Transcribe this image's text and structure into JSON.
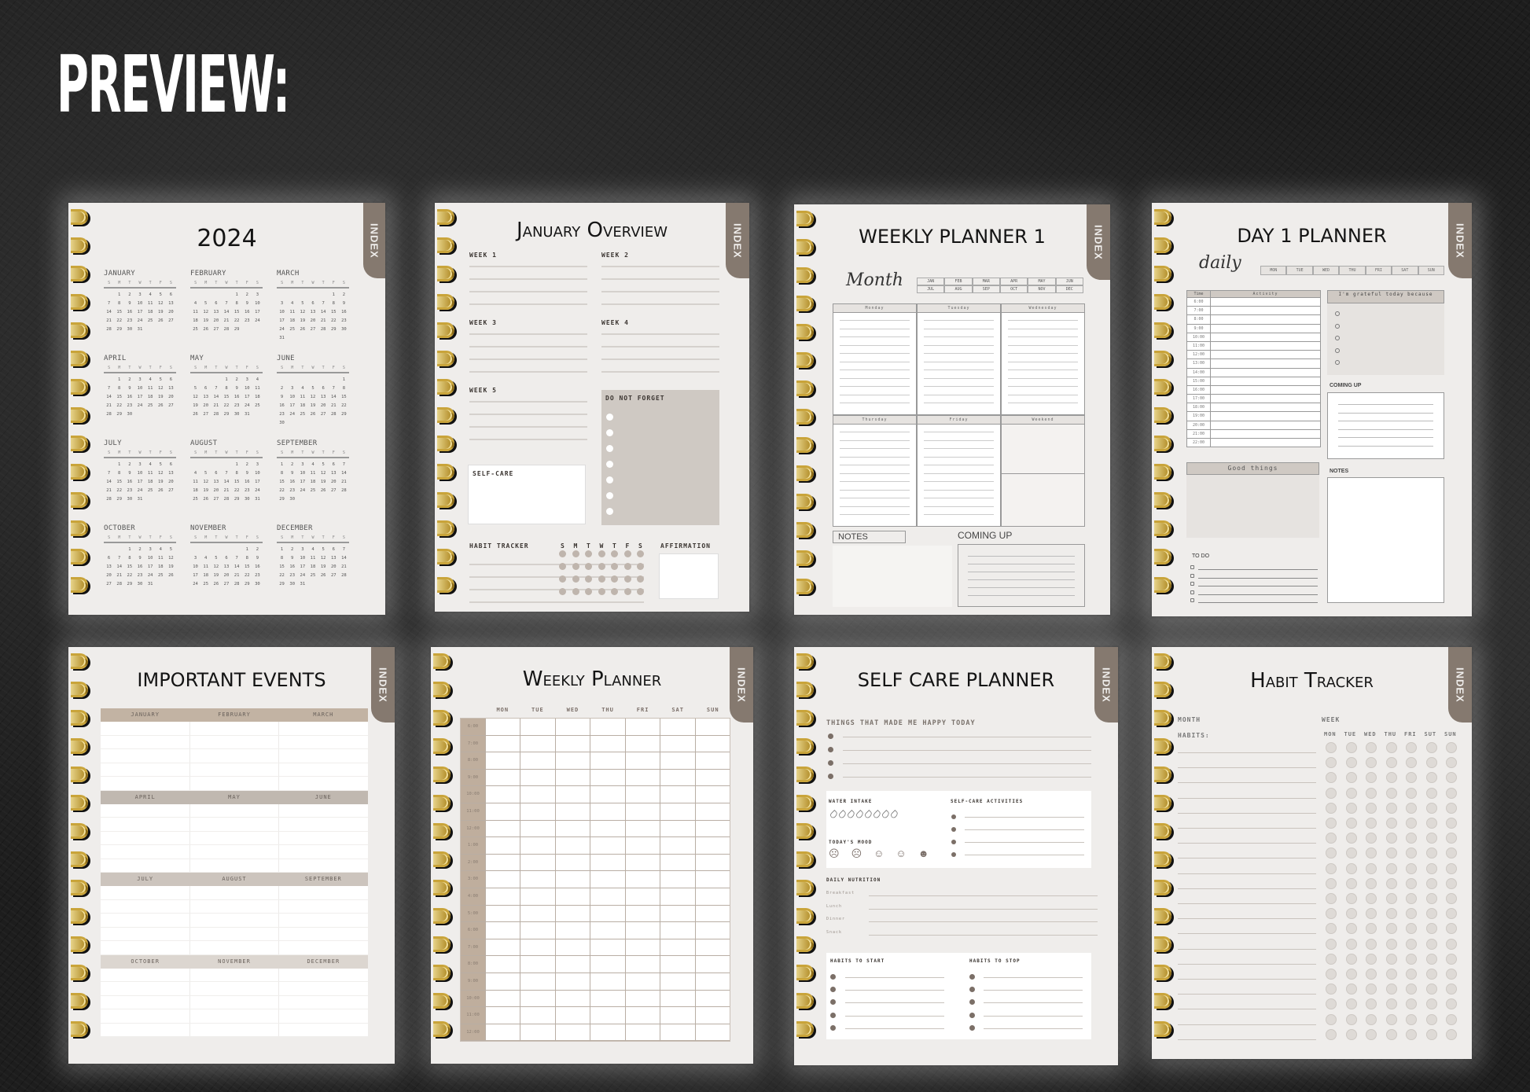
{
  "headline": "PREVIEW:",
  "index_label": "INDEX",
  "colors": {
    "accent_taupe": "#85796f",
    "tan": "#bfaf9f",
    "page": "#efedeb",
    "ring_gold": "#c9a43a"
  },
  "calendar": {
    "title": "2024",
    "dow": [
      "S",
      "M",
      "T",
      "W",
      "T",
      "F",
      "S"
    ],
    "months": [
      {
        "name": "JANUARY",
        "offset": 1,
        "days": 31
      },
      {
        "name": "FEBRUARY",
        "offset": 4,
        "days": 29
      },
      {
        "name": "MARCH",
        "offset": 5,
        "days": 31
      },
      {
        "name": "APRIL",
        "offset": 1,
        "days": 30
      },
      {
        "name": "MAY",
        "offset": 3,
        "days": 31
      },
      {
        "name": "JUNE",
        "offset": 6,
        "days": 30
      },
      {
        "name": "JULY",
        "offset": 1,
        "days": 31
      },
      {
        "name": "AUGUST",
        "offset": 4,
        "days": 31
      },
      {
        "name": "SEPTEMBER",
        "offset": 0,
        "days": 30
      },
      {
        "name": "OCTOBER",
        "offset": 2,
        "days": 31
      },
      {
        "name": "NOVEMBER",
        "offset": 5,
        "days": 30
      },
      {
        "name": "DECEMBER",
        "offset": 0,
        "days": 31
      }
    ]
  },
  "january_overview": {
    "title": "January Overview",
    "weeks": [
      "WEEK 1",
      "WEEK 2",
      "WEEK 3",
      "WEEK 4",
      "WEEK 5"
    ],
    "self_care": "SELF-CARE",
    "do_not_forget": "DO NOT FORGET",
    "habit_tracker": "HABIT TRACKER",
    "habit_days": [
      "S",
      "M",
      "T",
      "W",
      "T",
      "F",
      "S"
    ],
    "affirmation": "AFFIRMATION"
  },
  "weekly_planner_1": {
    "title": "WEEKLY PLANNER 1",
    "script_label": "Month",
    "months_row1": [
      "JAN",
      "FEB",
      "MAR",
      "APR",
      "MAY",
      "JUN"
    ],
    "months_row2": [
      "JUL",
      "AUG",
      "SEP",
      "OCT",
      "NOV",
      "DEC"
    ],
    "days": [
      "Monday",
      "Tuesday",
      "Wednesday",
      "Thursday",
      "Friday",
      "Weekend"
    ],
    "notes": "NOTES",
    "coming_up": "COMING UP"
  },
  "day_planner": {
    "title": "DAY 1 PLANNER",
    "script_label": "daily",
    "days": [
      "MON",
      "TUE",
      "WED",
      "THU",
      "FRI",
      "SAT",
      "SUN"
    ],
    "time_header": "Time",
    "activity_header": "Activity",
    "times": [
      "6:00",
      "7:00",
      "8:00",
      "9:00",
      "10:00",
      "11:00",
      "12:00",
      "13:00",
      "14:00",
      "15:00",
      "16:00",
      "17:00",
      "18:00",
      "19:00",
      "20:00",
      "21:00",
      "22:00"
    ],
    "grateful": "I'm grateful today because",
    "coming_up": "COMING UP",
    "good_things": "Good things",
    "notes": "NOTES",
    "todo": "TO DO"
  },
  "important_events": {
    "title": "IMPORTANT EVENTS",
    "quarters": [
      [
        "JANUARY",
        "FEBRUARY",
        "MARCH"
      ],
      [
        "APRIL",
        "MAY",
        "JUNE"
      ],
      [
        "JULY",
        "AUGUST",
        "SEPTEMBER"
      ],
      [
        "OCTOBER",
        "NOVEMBER",
        "DECEMBER"
      ]
    ]
  },
  "weekly_planner": {
    "title": "Weekly Planner",
    "days": [
      "MON",
      "TUE",
      "WED",
      "THU",
      "FRI",
      "SAT",
      "SUN"
    ],
    "times": [
      "6:00",
      "7:00",
      "8:00",
      "9:00",
      "10:00",
      "11:00",
      "12:00",
      "1:00",
      "2:00",
      "3:00",
      "4:00",
      "5:00",
      "6:00",
      "7:00",
      "8:00",
      "9:00",
      "10:00",
      "11:00",
      "12:00"
    ]
  },
  "self_care": {
    "title": "SELF CARE PLANNER",
    "happy": "THINGS THAT MADE ME HAPPY TODAY",
    "water": "WATER INTAKE",
    "water_drops": 8,
    "mood": "TODAY'S MOOD",
    "moods": [
      "☹",
      "☹",
      "☺",
      "☺",
      "☻"
    ],
    "activities": "SELF-CARE ACTIVITIES",
    "nutrition": "DAILY NUTRITION",
    "meals": [
      "Breakfast",
      "Lunch",
      "Dinner",
      "Snack"
    ],
    "habits_start": "HABITS TO START",
    "habits_stop": "HABITS TO STOP"
  },
  "habit_tracker": {
    "title": "Habit Tracker",
    "month": "MONTH",
    "habits": "HABITS:",
    "week": "WEEK",
    "days": [
      "MON",
      "TUE",
      "WED",
      "THU",
      "FRI",
      "SUT",
      "SUN"
    ],
    "rows": 20
  }
}
